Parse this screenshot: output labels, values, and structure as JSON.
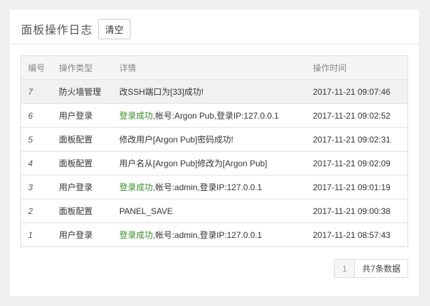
{
  "panel": {
    "title": "面板操作日志",
    "clear_label": "清空"
  },
  "table": {
    "headers": [
      "编号",
      "操作类型",
      "详情",
      "操作时间"
    ],
    "rows": [
      {
        "id": "7",
        "type": "防火墙管理",
        "detail_prefix": "",
        "detail": "改SSH端口为[33]成功!",
        "time": "2017-11-21 09:07:46"
      },
      {
        "id": "6",
        "type": "用户登录",
        "detail_prefix": "登录成功",
        "detail": ",帐号:Argon Pub,登录IP:127.0.0.1",
        "time": "2017-11-21 09:02:52"
      },
      {
        "id": "5",
        "type": "面板配置",
        "detail_prefix": "",
        "detail": "修改用户[Argon Pub]密码成功!",
        "time": "2017-11-21 09:02:31"
      },
      {
        "id": "4",
        "type": "面板配置",
        "detail_prefix": "",
        "detail": "用户名从[Argon Pub]修改为[Argon Pub]",
        "time": "2017-11-21 09:02:09"
      },
      {
        "id": "3",
        "type": "用户登录",
        "detail_prefix": "登录成功",
        "detail": ",帐号:admin,登录IP:127.0.0.1",
        "time": "2017-11-21 09:01:19"
      },
      {
        "id": "2",
        "type": "面板配置",
        "detail_prefix": "",
        "detail": "PANEL_SAVE",
        "time": "2017-11-21 09:00:38"
      },
      {
        "id": "1",
        "type": "用户登录",
        "detail_prefix": "登录成功",
        "detail": ",帐号:admin,登录IP:127.0.0.1",
        "time": "2017-11-21 08:57:43"
      }
    ]
  },
  "pagination": {
    "current_page": "1",
    "total_label": "共7条数据"
  },
  "colors": {
    "success_text": "#3a8b28"
  }
}
